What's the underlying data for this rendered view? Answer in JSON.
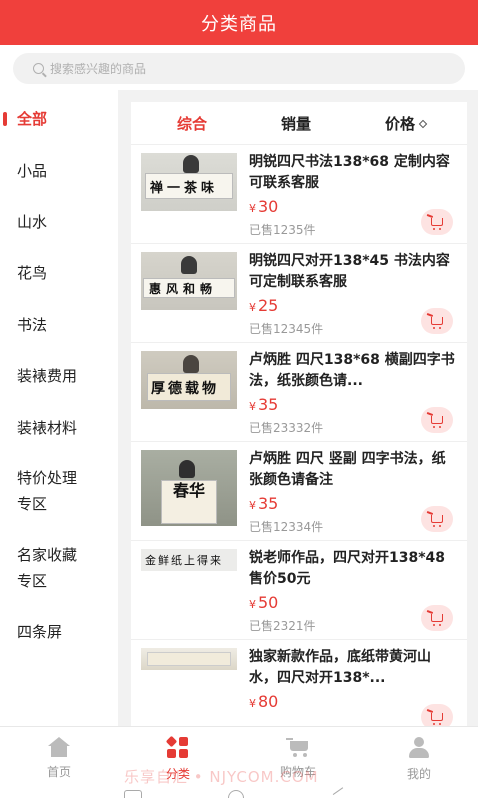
{
  "header": {
    "title": "分类商品"
  },
  "search": {
    "placeholder": "搜索感兴趣的商品"
  },
  "sidebar": {
    "items": [
      {
        "label": "全部",
        "active": true
      },
      {
        "label": "小品"
      },
      {
        "label": "山水"
      },
      {
        "label": "花鸟"
      },
      {
        "label": "书法"
      },
      {
        "label": "装裱费用"
      },
      {
        "label": "装裱材料"
      },
      {
        "label": "特价处理",
        "label2": "专区"
      },
      {
        "label": "名家收藏",
        "label2": "专区"
      },
      {
        "label": "四条屏"
      }
    ]
  },
  "sort": {
    "tabs": [
      {
        "label": "综合",
        "active": true
      },
      {
        "label": "销量"
      },
      {
        "label": "价格"
      }
    ]
  },
  "currency_symbol": "¥",
  "products": [
    {
      "title": "明锐四尺书法138*68 定制内容可联系客服",
      "price": "30",
      "sold": "已售1235件",
      "thumb_text": "禅一茶味"
    },
    {
      "title": "明锐四尺对开138*45 书法内容可定制联系客服",
      "price": "25",
      "sold": "已售12345件",
      "thumb_text": "惠风和畅"
    },
    {
      "title": "卢炳胜 四尺138*68 横副四字书法，纸张颜色请...",
      "price": "35",
      "sold": "已售23332件",
      "thumb_text": "厚德载物"
    },
    {
      "title": "卢炳胜 四尺 竖副 四字书法，纸张颜色请备注",
      "price": "35",
      "sold": "已售12334件",
      "thumb_text": "春华"
    },
    {
      "title": "锐老师作品，四尺对开138*48售价50元",
      "price": "50",
      "sold": "已售2321件",
      "thumb_text": "金鲜纸上得来"
    },
    {
      "title": "独家新款作品，底纸带黄河山水，四尺对开138*...",
      "price": "80",
      "sold": "",
      "thumb_text": ""
    }
  ],
  "tabbar": {
    "items": [
      {
        "label": "首页",
        "icon": "home-icon"
      },
      {
        "label": "分类",
        "icon": "category-icon",
        "active": true
      },
      {
        "label": "购物车",
        "icon": "cart-icon"
      },
      {
        "label": "我的",
        "icon": "user-icon"
      }
    ]
  },
  "watermark": "乐享自汇 • NJYCOM.COM",
  "colors": {
    "brand": "#f0403c",
    "accent": "#e53b35",
    "muted": "#999999"
  }
}
